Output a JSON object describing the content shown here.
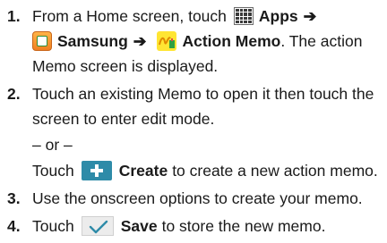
{
  "steps": [
    {
      "number": "1.",
      "line1_pre": "From a Home screen, touch",
      "apps_label": "Apps",
      "arrow": "➔",
      "samsung_label": "Samsung",
      "action_memo_label": "Action Memo",
      "line2_post": ". The action",
      "line3": "Memo screen is displayed.",
      "icons": [
        "apps-grid-icon",
        "samsung-folder-icon",
        "action-memo-icon"
      ]
    },
    {
      "number": "2.",
      "line1": "Touch an existing Memo to open it then touch the",
      "line2": "screen to enter edit mode.",
      "or_text": "– or –",
      "line4_pre": "Touch",
      "create_label": "Create",
      "line4_post": "to create a new action memo.",
      "icons": [
        "create-plus-icon"
      ]
    },
    {
      "number": "3.",
      "line1": "Use the onscreen options to create your memo."
    },
    {
      "number": "4.",
      "line1_pre": "Touch",
      "save_label": "Save",
      "line1_post": "to store the new memo.",
      "icons": [
        "save-check-icon"
      ]
    }
  ],
  "colors": {
    "text": "#1a1a1a",
    "create_icon_bg": "#2e8ba8",
    "memo_icon_bg": "#ffe533",
    "samsung_icon_bg": "#f07f22",
    "save_check": "#2e8ba8"
  }
}
